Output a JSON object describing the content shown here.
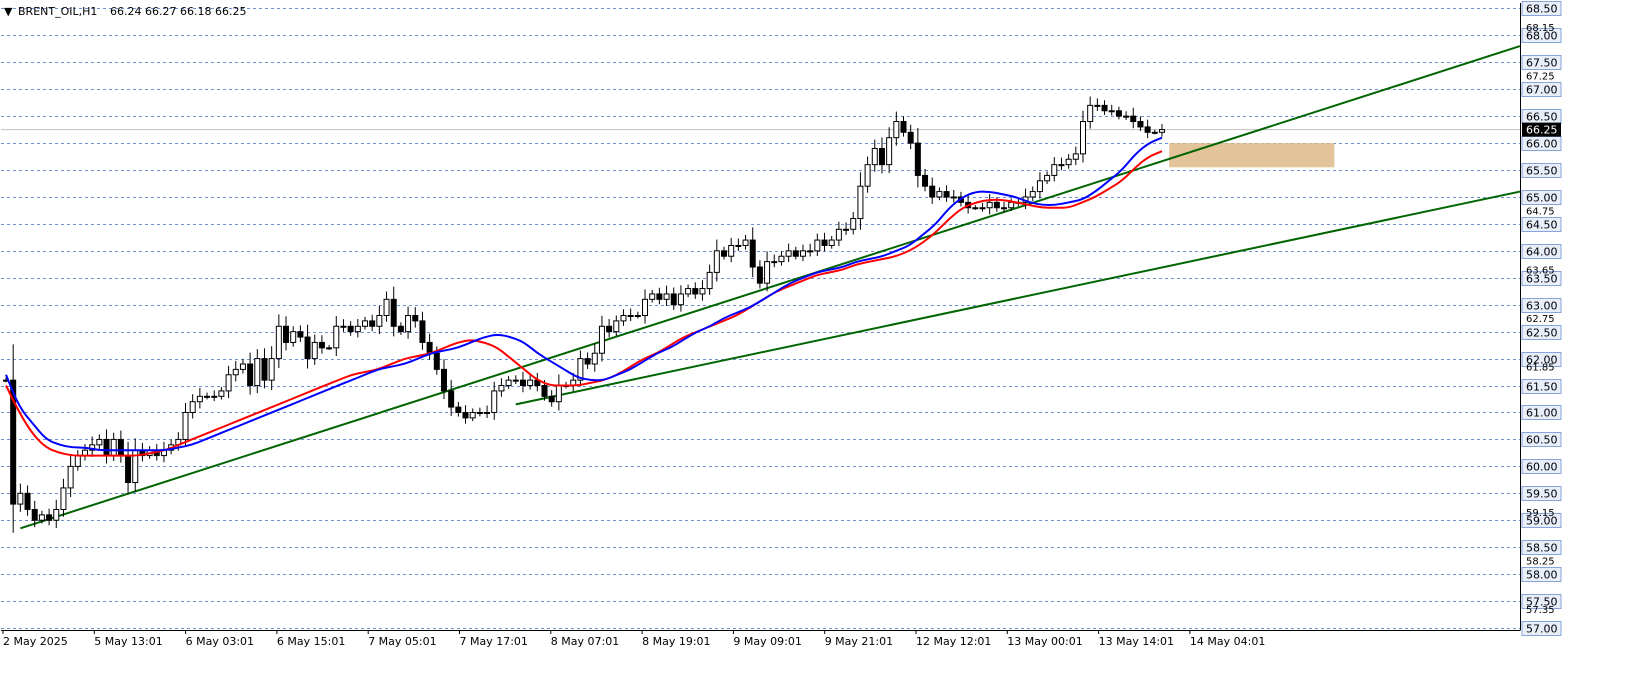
{
  "header": {
    "marker": "▼",
    "symbol": "BRENT_OIL,H1",
    "ohlc": "66.24 66.27 66.18 66.25"
  },
  "colors": {
    "candle": "#000000",
    "grid": "#6f8fd0",
    "ma_fast": "#0000ff",
    "ma_slow": "#ff0000",
    "trendline": "#006400",
    "zone": "#deb887",
    "current_price_bg": "#000000",
    "label_bg": "#e8eefa"
  },
  "chart_data": {
    "type": "candlestick",
    "symbol": "BRENT_OIL",
    "timeframe": "H1",
    "ylim": [
      57.0,
      68.6
    ],
    "y_ticks": [
      "68.50",
      "68.00",
      "67.50",
      "67.00",
      "66.50",
      "66.00",
      "65.50",
      "65.00",
      "64.50",
      "64.00",
      "63.50",
      "63.00",
      "62.50",
      "62.00",
      "61.50",
      "61.00",
      "60.50",
      "60.00",
      "59.50",
      "59.00",
      "58.50",
      "58.00",
      "57.50",
      "57.00"
    ],
    "y_minor_ticks": [
      "68.15",
      "67.25",
      "64.75",
      "63.65",
      "62.75",
      "61.85",
      "59.15",
      "58.25",
      "57.35"
    ],
    "current_price": "66.25",
    "x_labels": [
      "2 May 2025",
      "5 May 13:01",
      "6 May 03:01",
      "6 May 15:01",
      "7 May 05:01",
      "7 May 17:01",
      "8 May 07:01",
      "8 May 19:01",
      "9 May 09:01",
      "9 May 21:01",
      "12 May 12:01",
      "13 May 00:01",
      "13 May 14:01",
      "14 May 04:01"
    ],
    "close": [
      61.6,
      59.3,
      59.5,
      59.2,
      59.0,
      59.1,
      59.0,
      59.2,
      59.6,
      60.0,
      60.2,
      60.3,
      60.4,
      60.5,
      60.2,
      60.5,
      60.2,
      59.7,
      60.3,
      60.2,
      60.3,
      60.2,
      60.3,
      60.4,
      60.5,
      61.0,
      61.2,
      61.3,
      61.3,
      61.3,
      61.4,
      61.7,
      61.8,
      61.9,
      61.5,
      62.0,
      61.6,
      62.0,
      62.6,
      62.3,
      62.5,
      62.4,
      62.0,
      62.3,
      62.2,
      62.2,
      62.6,
      62.6,
      62.5,
      62.6,
      62.7,
      62.6,
      62.8,
      63.1,
      62.6,
      62.5,
      62.8,
      62.7,
      62.3,
      62.1,
      61.8,
      61.4,
      61.1,
      61.0,
      60.9,
      61.0,
      61.0,
      61.0,
      61.4,
      61.5,
      61.6,
      61.6,
      61.5,
      61.6,
      61.5,
      61.3,
      61.2,
      61.5,
      61.5,
      61.6,
      62.0,
      61.9,
      62.1,
      62.6,
      62.5,
      62.7,
      62.8,
      62.8,
      62.8,
      63.1,
      63.2,
      63.1,
      63.2,
      63.0,
      63.2,
      63.3,
      63.2,
      63.3,
      63.6,
      64.0,
      63.9,
      64.1,
      64.1,
      64.2,
      63.7,
      63.4,
      63.8,
      63.8,
      63.9,
      64.0,
      63.9,
      64.0,
      64.0,
      64.2,
      64.1,
      64.2,
      64.4,
      64.4,
      64.6,
      65.2,
      65.6,
      65.9,
      65.6,
      66.1,
      66.4,
      66.2,
      66.0,
      65.4,
      65.2,
      65.0,
      65.1,
      65.0,
      65.0,
      64.9,
      64.8,
      64.8,
      64.8,
      64.9,
      64.8,
      64.8,
      64.9,
      64.9,
      65.0,
      65.1,
      65.3,
      65.4,
      65.6,
      65.6,
      65.7,
      65.8,
      66.4,
      66.7,
      66.7,
      66.6,
      66.6,
      66.5,
      66.5,
      66.4,
      66.3,
      66.2,
      66.2,
      66.25
    ],
    "ma_fast": [
      61.7,
      61.1,
      60.8,
      60.5,
      60.4,
      60.35,
      60.35,
      60.3,
      60.3,
      60.3,
      60.3,
      60.3,
      60.3,
      60.35,
      60.4,
      60.5,
      60.6,
      60.7,
      60.8,
      60.9,
      61.0,
      61.1,
      61.2,
      61.3,
      61.4,
      61.5,
      61.6,
      61.7,
      61.8,
      61.85,
      61.9,
      62.0,
      62.1,
      62.15,
      62.2,
      62.3,
      62.4,
      62.45,
      62.4,
      62.3,
      62.1,
      61.95,
      61.8,
      61.65,
      61.6,
      61.6,
      61.7,
      61.8,
      61.95,
      62.1,
      62.2,
      62.35,
      62.5,
      62.6,
      62.75,
      62.85,
      62.95,
      63.1,
      63.25,
      63.4,
      63.5,
      63.6,
      63.65,
      63.7,
      63.8,
      63.85,
      63.9,
      64.0,
      64.1,
      64.3,
      64.5,
      64.8,
      65.0,
      65.1,
      65.1,
      65.05,
      65.0,
      64.9,
      64.85,
      64.85,
      64.9,
      64.95,
      65.1,
      65.3,
      65.5,
      65.8,
      66.0,
      66.1
    ],
    "ma_slow": [
      61.5,
      61.0,
      60.6,
      60.35,
      60.25,
      60.2,
      60.2,
      60.2,
      60.2,
      60.2,
      60.2,
      60.25,
      60.3,
      60.4,
      60.5,
      60.6,
      60.7,
      60.8,
      60.9,
      61.0,
      61.1,
      61.2,
      61.3,
      61.4,
      61.5,
      61.6,
      61.7,
      61.75,
      61.8,
      61.9,
      62.0,
      62.05,
      62.1,
      62.2,
      62.3,
      62.35,
      62.3,
      62.2,
      62.0,
      61.8,
      61.6,
      61.5,
      61.5,
      61.5,
      61.55,
      61.6,
      61.7,
      61.85,
      62.0,
      62.1,
      62.25,
      62.4,
      62.5,
      62.6,
      62.7,
      62.8,
      62.95,
      63.1,
      63.25,
      63.35,
      63.45,
      63.55,
      63.6,
      63.65,
      63.75,
      63.8,
      63.85,
      63.9,
      64.0,
      64.15,
      64.35,
      64.6,
      64.8,
      64.9,
      64.95,
      64.95,
      64.9,
      64.85,
      64.8,
      64.8,
      64.8,
      64.9,
      65.0,
      65.15,
      65.3,
      65.55,
      65.75,
      65.85
    ],
    "trendlines": [
      {
        "from": {
          "bar": 2,
          "price": 58.85
        },
        "to": {
          "bar": 213,
          "price": 67.8
        }
      },
      {
        "from": {
          "bar": 71,
          "price": 61.15
        },
        "to": {
          "bar": 213,
          "price": 65.1
        }
      }
    ],
    "zone": {
      "from_bar": 162,
      "to_bar": 185,
      "price_low": 65.55,
      "price_high": 66.0
    }
  }
}
